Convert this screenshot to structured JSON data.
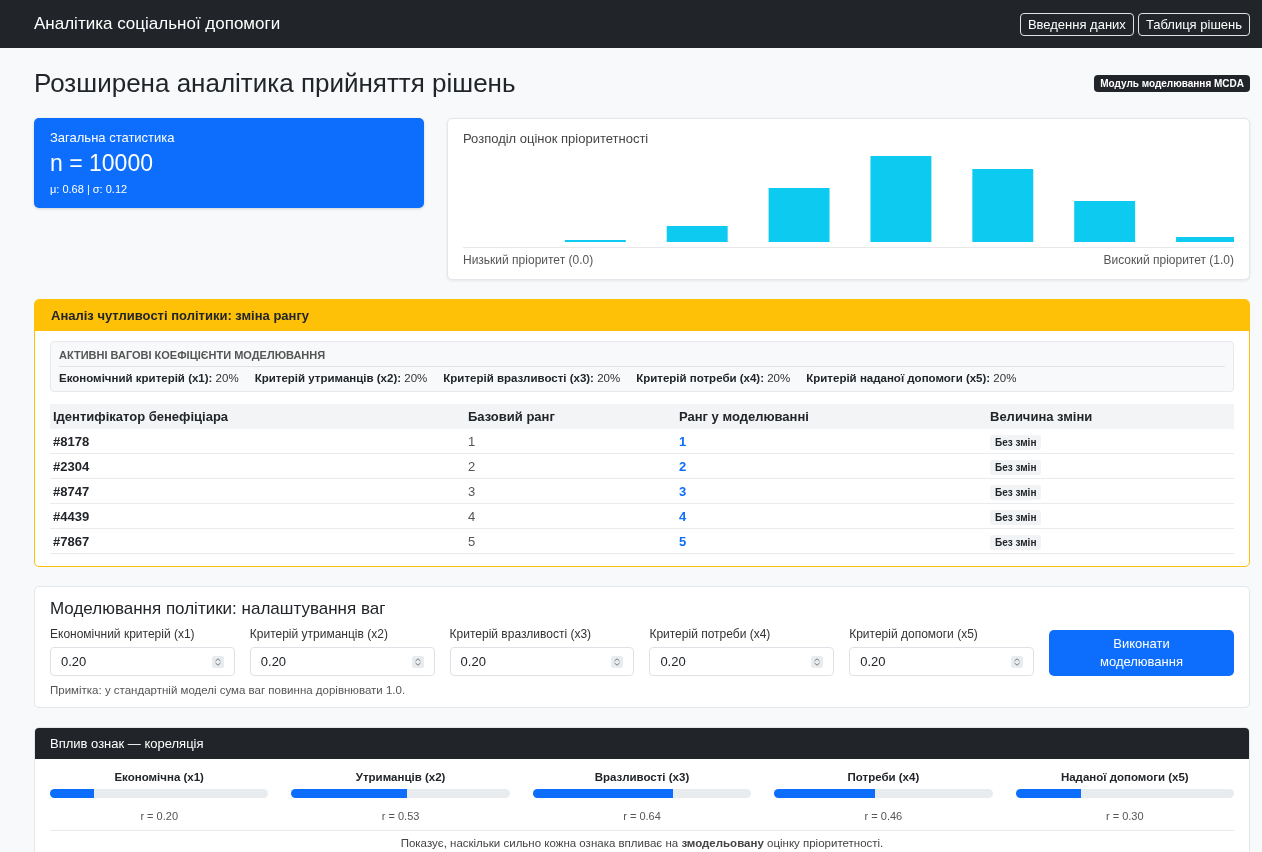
{
  "navbar": {
    "brand": "Аналітика соціальної допомоги",
    "buttons": [
      "Введення даних",
      "Таблиця рішень"
    ]
  },
  "page": {
    "title": "Розширена аналітика прийняття рішень",
    "badge": "Модуль моделювання MCDA"
  },
  "stats": {
    "title": "Загальна статистика",
    "n": "n = 10000",
    "summary": "μ: 0.68 | σ: 0.12"
  },
  "histogram": {
    "title": "Розподіл оцінок пріоритетності",
    "low_label": "Низький пріоритет (0.0)",
    "high_label": "Високий пріоритет (1.0)"
  },
  "sensitivity": {
    "title": "Аналіз чутливості політики: зміна рангу",
    "weights_title": "АКТИВНІ ВАГОВІ КОЕФІЦІЄНТИ МОДЕЛЮВАННЯ",
    "weights": [
      {
        "label": "Економічний критерій (x1):",
        "value": "20%"
      },
      {
        "label": "Критерій утриманців (x2):",
        "value": "20%"
      },
      {
        "label": "Критерій вразливості (x3):",
        "value": "20%"
      },
      {
        "label": "Критерій потреби (x4):",
        "value": "20%"
      },
      {
        "label": "Критерій наданої допомоги (x5):",
        "value": "20%"
      }
    ],
    "columns": [
      "Ідентифікатор бенефіціара",
      "Базовий ранг",
      "Ранг у моделюванні",
      "Величина зміни"
    ],
    "rows": [
      {
        "id": "#8178",
        "base": "1",
        "sim": "1",
        "change": "Без змін"
      },
      {
        "id": "#2304",
        "base": "2",
        "sim": "2",
        "change": "Без змін"
      },
      {
        "id": "#8747",
        "base": "3",
        "sim": "3",
        "change": "Без змін"
      },
      {
        "id": "#4439",
        "base": "4",
        "sim": "4",
        "change": "Без змін"
      },
      {
        "id": "#7867",
        "base": "5",
        "sim": "5",
        "change": "Без змін"
      }
    ]
  },
  "simulation": {
    "title": "Моделювання політики: налаштування ваг",
    "fields": [
      {
        "label": "Економічний критерій (x1)",
        "value": "0.20"
      },
      {
        "label": "Критерій утриманців (x2)",
        "value": "0.20"
      },
      {
        "label": "Критерій вразливості (x3)",
        "value": "0.20"
      },
      {
        "label": "Критерій потреби (x4)",
        "value": "0.20"
      },
      {
        "label": "Критерій допомоги (x5)",
        "value": "0.20"
      }
    ],
    "button": "Виконати моделювання",
    "note": "Примітка: у стандартній моделі сума ваг повинна дорівнювати 1.0."
  },
  "correlation": {
    "title": "Вплив ознак — кореляція",
    "features": [
      {
        "name": "Економічна (x1)",
        "level": 0.2,
        "reading": "r = 0.20"
      },
      {
        "name": "Утриманців (x2)",
        "level": 0.53,
        "reading": "r = 0.53"
      },
      {
        "name": "Вразливості (x3)",
        "level": 0.64,
        "reading": "r = 0.64"
      },
      {
        "name": "Потреби (x4)",
        "level": 0.46,
        "reading": "r = 0.46"
      },
      {
        "name": "Наданої допомоги (x5)",
        "level": 0.3,
        "reading": "r = 0.30"
      }
    ],
    "footnote": "Показує, наскільки сильно кожна ознака впливає на **змодельовану** оцінку пріоритетності."
  }
}
